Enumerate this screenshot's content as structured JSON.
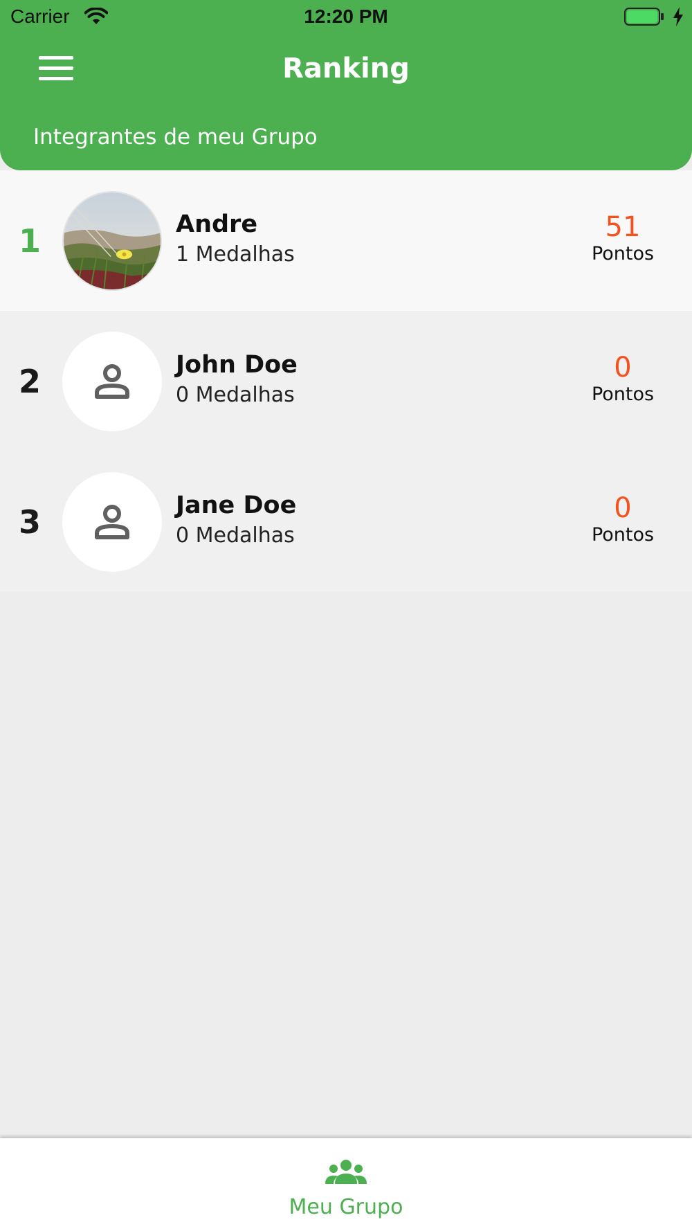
{
  "status_bar": {
    "carrier": "Carrier",
    "time": "12:20 PM"
  },
  "header": {
    "title": "Ranking",
    "subtitle": "Integrantes de meu Grupo",
    "menu_icon": "hamburger-menu-icon"
  },
  "ranking": [
    {
      "rank": "1",
      "name": "Andre",
      "medals": "1 Medalhas",
      "points": "51",
      "points_label": "Pontos",
      "avatar": "photo"
    },
    {
      "rank": "2",
      "name": "John Doe",
      "medals": "0 Medalhas",
      "points": "0",
      "points_label": "Pontos",
      "avatar": "person-icon"
    },
    {
      "rank": "3",
      "name": "Jane Doe",
      "medals": "0 Medalhas",
      "points": "0",
      "points_label": "Pontos",
      "avatar": "person-icon"
    }
  ],
  "tabbar": {
    "tab_label": "Meu Grupo",
    "tab_icon": "group-icon"
  },
  "colors": {
    "primary": "#4caf50",
    "points": "#f4511e",
    "background": "#ededed"
  }
}
